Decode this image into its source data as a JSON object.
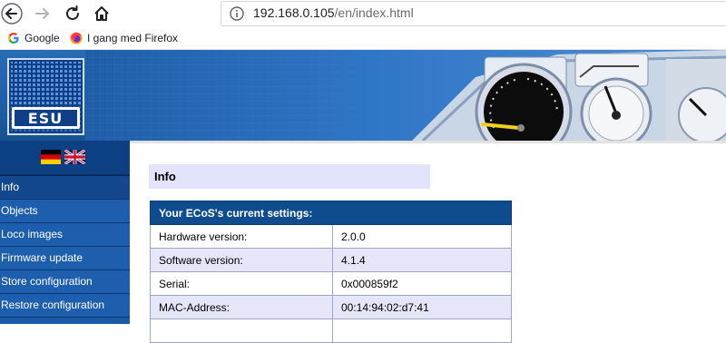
{
  "browser": {
    "url_host": "192.168.0.105",
    "url_path": "/en/index.html",
    "bookmarks": [
      {
        "label": "Google",
        "icon": "google-icon"
      },
      {
        "label": "I gang med Firefox",
        "icon": "firefox-icon"
      }
    ]
  },
  "header": {
    "logo_text": "ESU",
    "logo_icon": "esu-logo"
  },
  "languages": [
    {
      "name": "german-flag-icon"
    },
    {
      "name": "uk-flag-icon"
    }
  ],
  "menu": [
    {
      "label": "Info",
      "active": true
    },
    {
      "label": "Objects"
    },
    {
      "label": "Loco images"
    },
    {
      "label": "Firmware update"
    },
    {
      "label": "Store configuration"
    },
    {
      "label": "Restore configuration"
    }
  ],
  "main": {
    "heading": "Info",
    "table_title": "Your ECoS's current settings:",
    "rows": [
      {
        "label": "Hardware version:",
        "value": "2.0.0"
      },
      {
        "label": "Software version:",
        "value": "4.1.4"
      },
      {
        "label": "Serial:",
        "value": "0x000859f2"
      },
      {
        "label": "MAC-Address:",
        "value": "00:14:94:02:d7:41"
      },
      {
        "label": "",
        "value": ""
      }
    ]
  },
  "colors": {
    "menu_bg": "#1d5fad",
    "table_header_bg": "#0e4c8e",
    "row_alt_bg": "#e6e6fa",
    "heading_bg": "#e3e3fb"
  }
}
